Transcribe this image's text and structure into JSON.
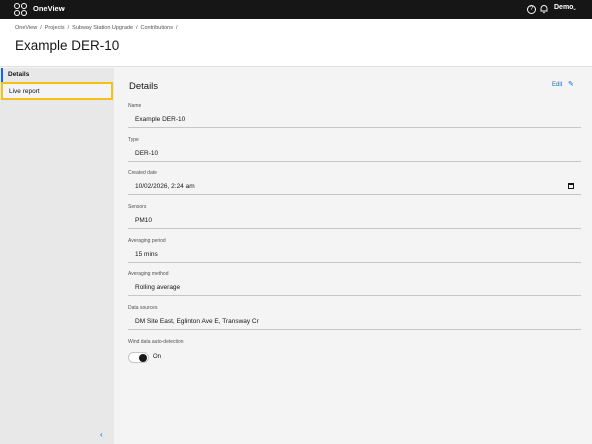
{
  "topbar": {
    "brand": "OneView",
    "user": "Demo",
    "help_glyph": "?",
    "chevron_glyph": "⌄"
  },
  "breadcrumb": [
    "OneView",
    "Projects",
    "Subway Station Upgrade",
    "Contributions"
  ],
  "breadcrumb_sep": "/",
  "page_title": "Example DER-10",
  "sidebar": {
    "items": [
      {
        "label": "Details",
        "active": true
      },
      {
        "label": "Live report",
        "highlighted": true
      }
    ],
    "collapse_glyph": "‹"
  },
  "details": {
    "title": "Details",
    "edit_label": "Edit",
    "edit_glyph": "✎",
    "fields": [
      {
        "label": "Name",
        "value": "Example DER-10"
      },
      {
        "label": "Type",
        "value": "DER-10"
      },
      {
        "label": "Created date",
        "value": "10/02/2026, 2:24 am"
      },
      {
        "label": "Sensors",
        "value": "PM10"
      },
      {
        "label": "Averaging period",
        "value": "15 mins"
      },
      {
        "label": "Averaging method",
        "value": "Rolling average"
      },
      {
        "label": "Data sources",
        "value": "DM Site East, Eglinton Ave E, Transway Cr"
      }
    ],
    "toggle": {
      "label": "Wind data auto-detection",
      "state_text": "On",
      "on": true
    }
  },
  "colors": {
    "accent": "#0f62fe",
    "highlight": "#f1c21b",
    "topbar": "#161616"
  }
}
